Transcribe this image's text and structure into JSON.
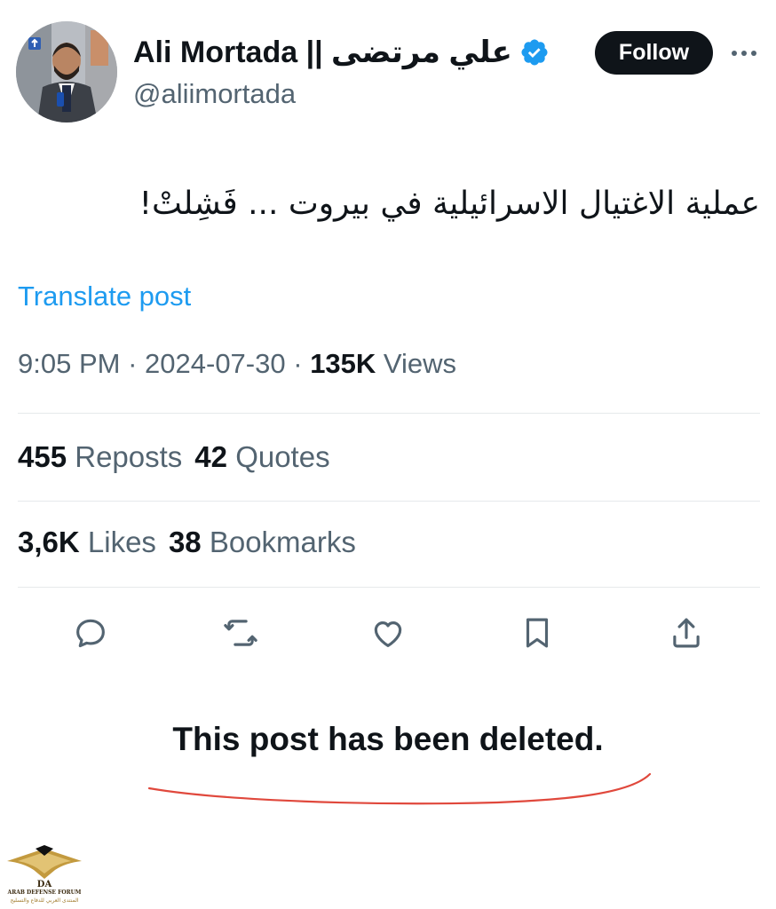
{
  "author": {
    "display_name": "Ali Mortada || علي مرتضى",
    "handle": "@aliimortada",
    "verified": true,
    "verified_color": "#1d9bf0"
  },
  "header": {
    "follow_label": "Follow",
    "more_icon": "more-horizontal-icon"
  },
  "post": {
    "text": "عملية الاغتيال الاسرائيلية في بيروت ... فَشِلتْ!",
    "translate_label": "Translate post",
    "time": "9:05 PM",
    "date": "2024-07-30",
    "views_count": "135K",
    "views_label": "Views",
    "separator": "·"
  },
  "stats": {
    "reposts_count": "455",
    "reposts_label": "Reposts",
    "quotes_count": "42",
    "quotes_label": "Quotes",
    "likes_count": "3,6K",
    "likes_label": "Likes",
    "bookmarks_count": "38",
    "bookmarks_label": "Bookmarks"
  },
  "actions": [
    "reply-icon",
    "repost-icon",
    "like-icon",
    "bookmark-icon",
    "share-icon"
  ],
  "annotation": {
    "text": "This post has been deleted.",
    "underline_color": "#e0483c"
  },
  "watermark": {
    "logo_letters": "DA",
    "title": "ARAB DEFENSE FORUM",
    "subtitle": "المنتدى العربي للدفاع والتسليح"
  },
  "colors": {
    "text_primary": "#0f1419",
    "text_secondary": "#536471",
    "link": "#1d9bf0",
    "divider": "#e6e9eb"
  }
}
